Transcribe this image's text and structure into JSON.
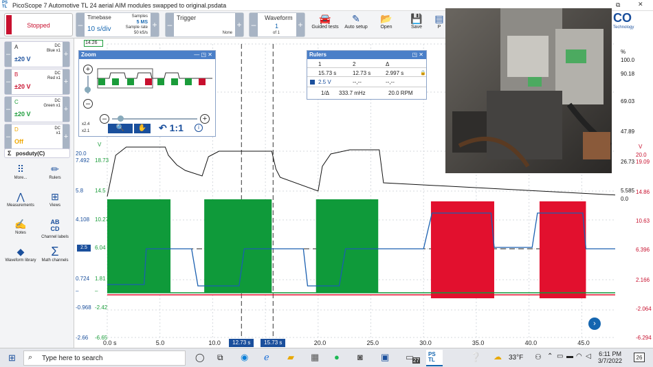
{
  "app": {
    "title": "PicoScope 7 Automotive TL 24 aerial AIM modules swapped to original.psdata",
    "logo": "PS\nTL"
  },
  "toolbar": {
    "run_state": "Stopped",
    "timebase_label": "Timebase",
    "timebase_value": "10 s/div",
    "samples_label": "Samples",
    "samples_value": "5 MS",
    "sample_rate_label": "Sample rate",
    "sample_rate_value": "50 kS/s",
    "trigger_label": "Trigger",
    "trigger_value": "None",
    "waveform_label": "Waveform",
    "waveform_value": "1",
    "waveform_of": "of 1",
    "guided": "Guided tests",
    "autosetup": "Auto setup",
    "open": "Open",
    "save": "Save",
    "p": "P"
  },
  "channels": [
    {
      "letter": "A",
      "range": "±20 V",
      "coupling": "DC",
      "info": "Blue x1",
      "color": "#1a4f9c"
    },
    {
      "letter": "B",
      "range": "±20 V",
      "coupling": "DC",
      "info": "Red x1",
      "color": "#c8102e"
    },
    {
      "letter": "C",
      "range": "±20 V",
      "coupling": "DC",
      "info": "Green x1",
      "color": "#1a9c3a"
    },
    {
      "letter": "D",
      "range": "Off",
      "coupling": "DC",
      "info": "x1",
      "color": "#f0a800"
    }
  ],
  "math": {
    "label": "posduty(C)"
  },
  "tools": [
    {
      "label": "More...",
      "icon": "grid-icon"
    },
    {
      "label": "Rulers",
      "icon": "ruler-icon"
    },
    {
      "label": "Measurements",
      "icon": "compass-icon"
    },
    {
      "label": "Views",
      "icon": "views-icon"
    },
    {
      "label": "Notes",
      "icon": "notes-icon"
    },
    {
      "label": "Channel labels",
      "icon": "abcd-icon"
    },
    {
      "label": "Waveform library",
      "icon": "library-icon"
    },
    {
      "label": "Math channels",
      "icon": "sigma-icon"
    }
  ],
  "zoom": {
    "title": "Zoom",
    "ratio": "1:1",
    "x_scale": "x2.4",
    "y_scale": "x2.1"
  },
  "rulers": {
    "title": "Rulers",
    "col1": "1",
    "col2": "2",
    "col3": "Δ",
    "r1": "15.73 s",
    "r2": "12.73 s",
    "rd": "2.997 s",
    "level": "2.5 V",
    "l2": "--,--",
    "l3": "--,--",
    "inv": "1/Δ",
    "freq": "333.7 mHz",
    "rpm": "20.0 RPM"
  },
  "plot": {
    "start_marker": "14.26",
    "x_ticks": [
      "0.0 s",
      "5.0",
      "10.0",
      "15.0",
      "20.0",
      "25.0",
      "30.0",
      "35.0",
      "40.0",
      "45.0"
    ],
    "x_ticks_val": [
      0,
      5,
      10,
      15,
      20,
      25,
      30,
      35,
      40,
      45
    ],
    "cursor1": "12.73 s",
    "cursor1_val": 12.73,
    "cursor2": "15.73 s",
    "cursor2_val": 15.73,
    "trigger_level": "2.5",
    "left_axis_a": [
      "20.0",
      "7.492",
      "5.8",
      "4.108",
      "2.5",
      "0.724",
      "–",
      "-0.968",
      "-2.66"
    ],
    "left_axis_c": [
      "18.73",
      "14.5",
      "10.27",
      "6.04",
      "1.81",
      "–",
      "-2.42",
      "-6.65"
    ],
    "c_unit": "V",
    "right_axis_black": [
      "%",
      "100.0",
      "90.18",
      "69.03",
      "47.89",
      "26.73",
      "5.585",
      "0.0"
    ],
    "right_axis_red": [
      "V",
      "20.0",
      "19.09",
      "14.86",
      "10.63",
      "6.396",
      "2.166",
      "-2.064",
      "-6.294"
    ]
  },
  "taskbar": {
    "search": "Type here to search",
    "temp": "33°F",
    "time": "6:11 PM",
    "date": "3/7/2022",
    "notif": "26",
    "badge": "27"
  }
}
